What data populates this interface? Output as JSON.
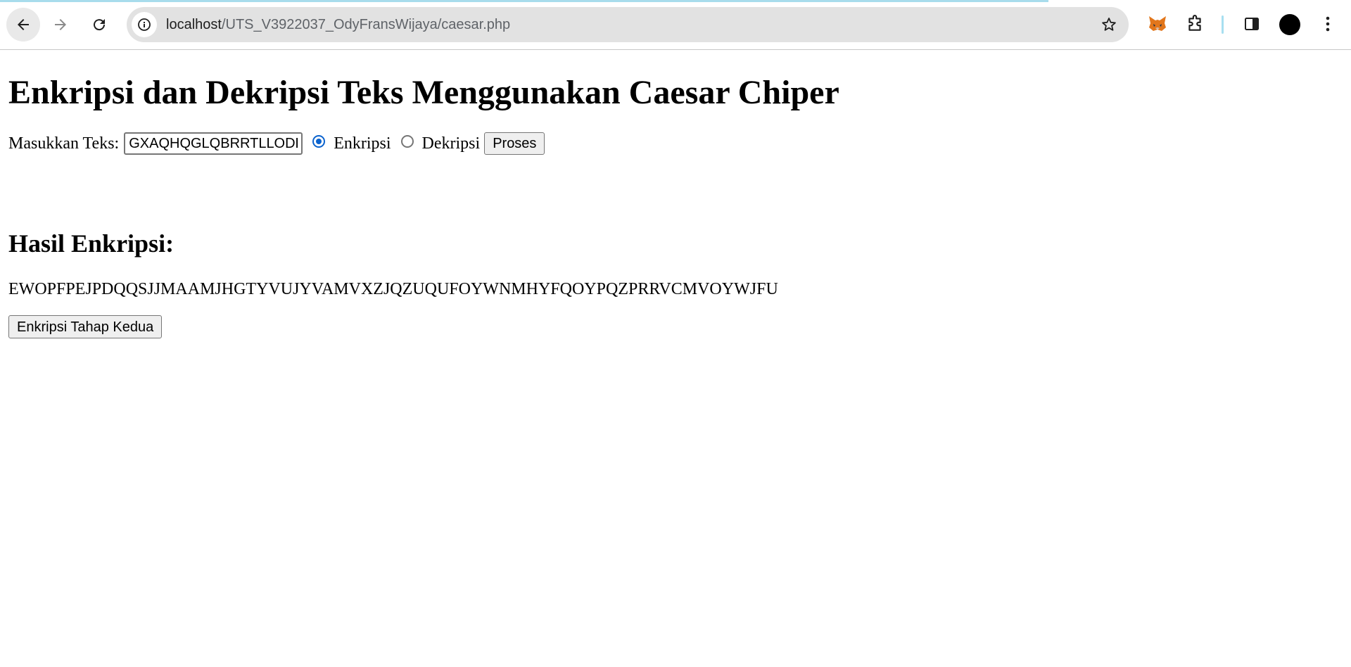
{
  "browser": {
    "url_host": "localhost",
    "url_path": "/UTS_V3922037_OdyFransWijaya/caesar.php",
    "icons": [
      "back-arrow-icon",
      "forward-arrow-icon",
      "reload-icon",
      "site-info-icon",
      "bookmark-star-icon",
      "metamask-fox-icon",
      "extensions-puzzle-icon",
      "side-panel-icon",
      "profile-avatar",
      "kebab-menu-icon"
    ]
  },
  "page": {
    "title": "Enkripsi dan Dekripsi Teks Menggunakan Caesar Chiper",
    "form": {
      "input_label": "Masukkan Teks:",
      "input_value": "GXAQHQGLQBRRTLLODD",
      "radio_encrypt_label": "Enkripsi",
      "radio_decrypt_label": "Dekripsi",
      "selected_mode": "Enkripsi",
      "submit_label": "Proses"
    },
    "result": {
      "heading": "Hasil Enkripsi:",
      "text": "EWOPFPEJPDQQSJJMAAMJHGTYVUJYVAMVXZJQZUQUFOYWNMHYFQOYPQZPRRVCMVOYWJFU"
    },
    "second_stage_label": "Enkripsi Tahap Kedua"
  },
  "colors": {
    "radio_checked": "#0b63ce",
    "omnibox_bg": "#e2e2e2",
    "load_bar": "#a8dcec"
  }
}
